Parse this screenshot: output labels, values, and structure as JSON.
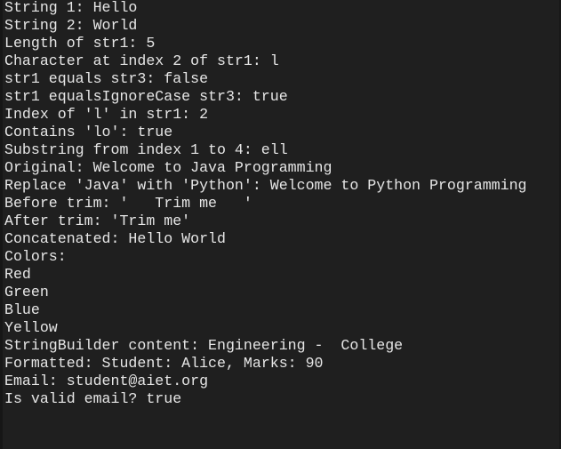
{
  "console": {
    "lines": [
      "String 1: Hello",
      "String 2: World",
      "Length of str1: 5",
      "Character at index 2 of str1: l",
      "str1 equals str3: false",
      "str1 equalsIgnoreCase str3: true",
      "Index of 'l' in str1: 2",
      "Contains 'lo': true",
      "Substring from index 1 to 4: ell",
      "Original: Welcome to Java Programming",
      "Replace 'Java' with 'Python': Welcome to Python Programming",
      "Before trim: '   Trim me   '",
      "After trim: 'Trim me'",
      "Concatenated: Hello World",
      "Colors:",
      "Red",
      "Green",
      "Blue",
      "Yellow",
      "StringBuilder content: Engineering -  College",
      "Formatted: Student: Alice, Marks: 90",
      "Email: student@aiet.org",
      "Is valid email? true"
    ]
  },
  "colors": {
    "background": "#1f1f1f",
    "text": "#e6e6e6"
  }
}
